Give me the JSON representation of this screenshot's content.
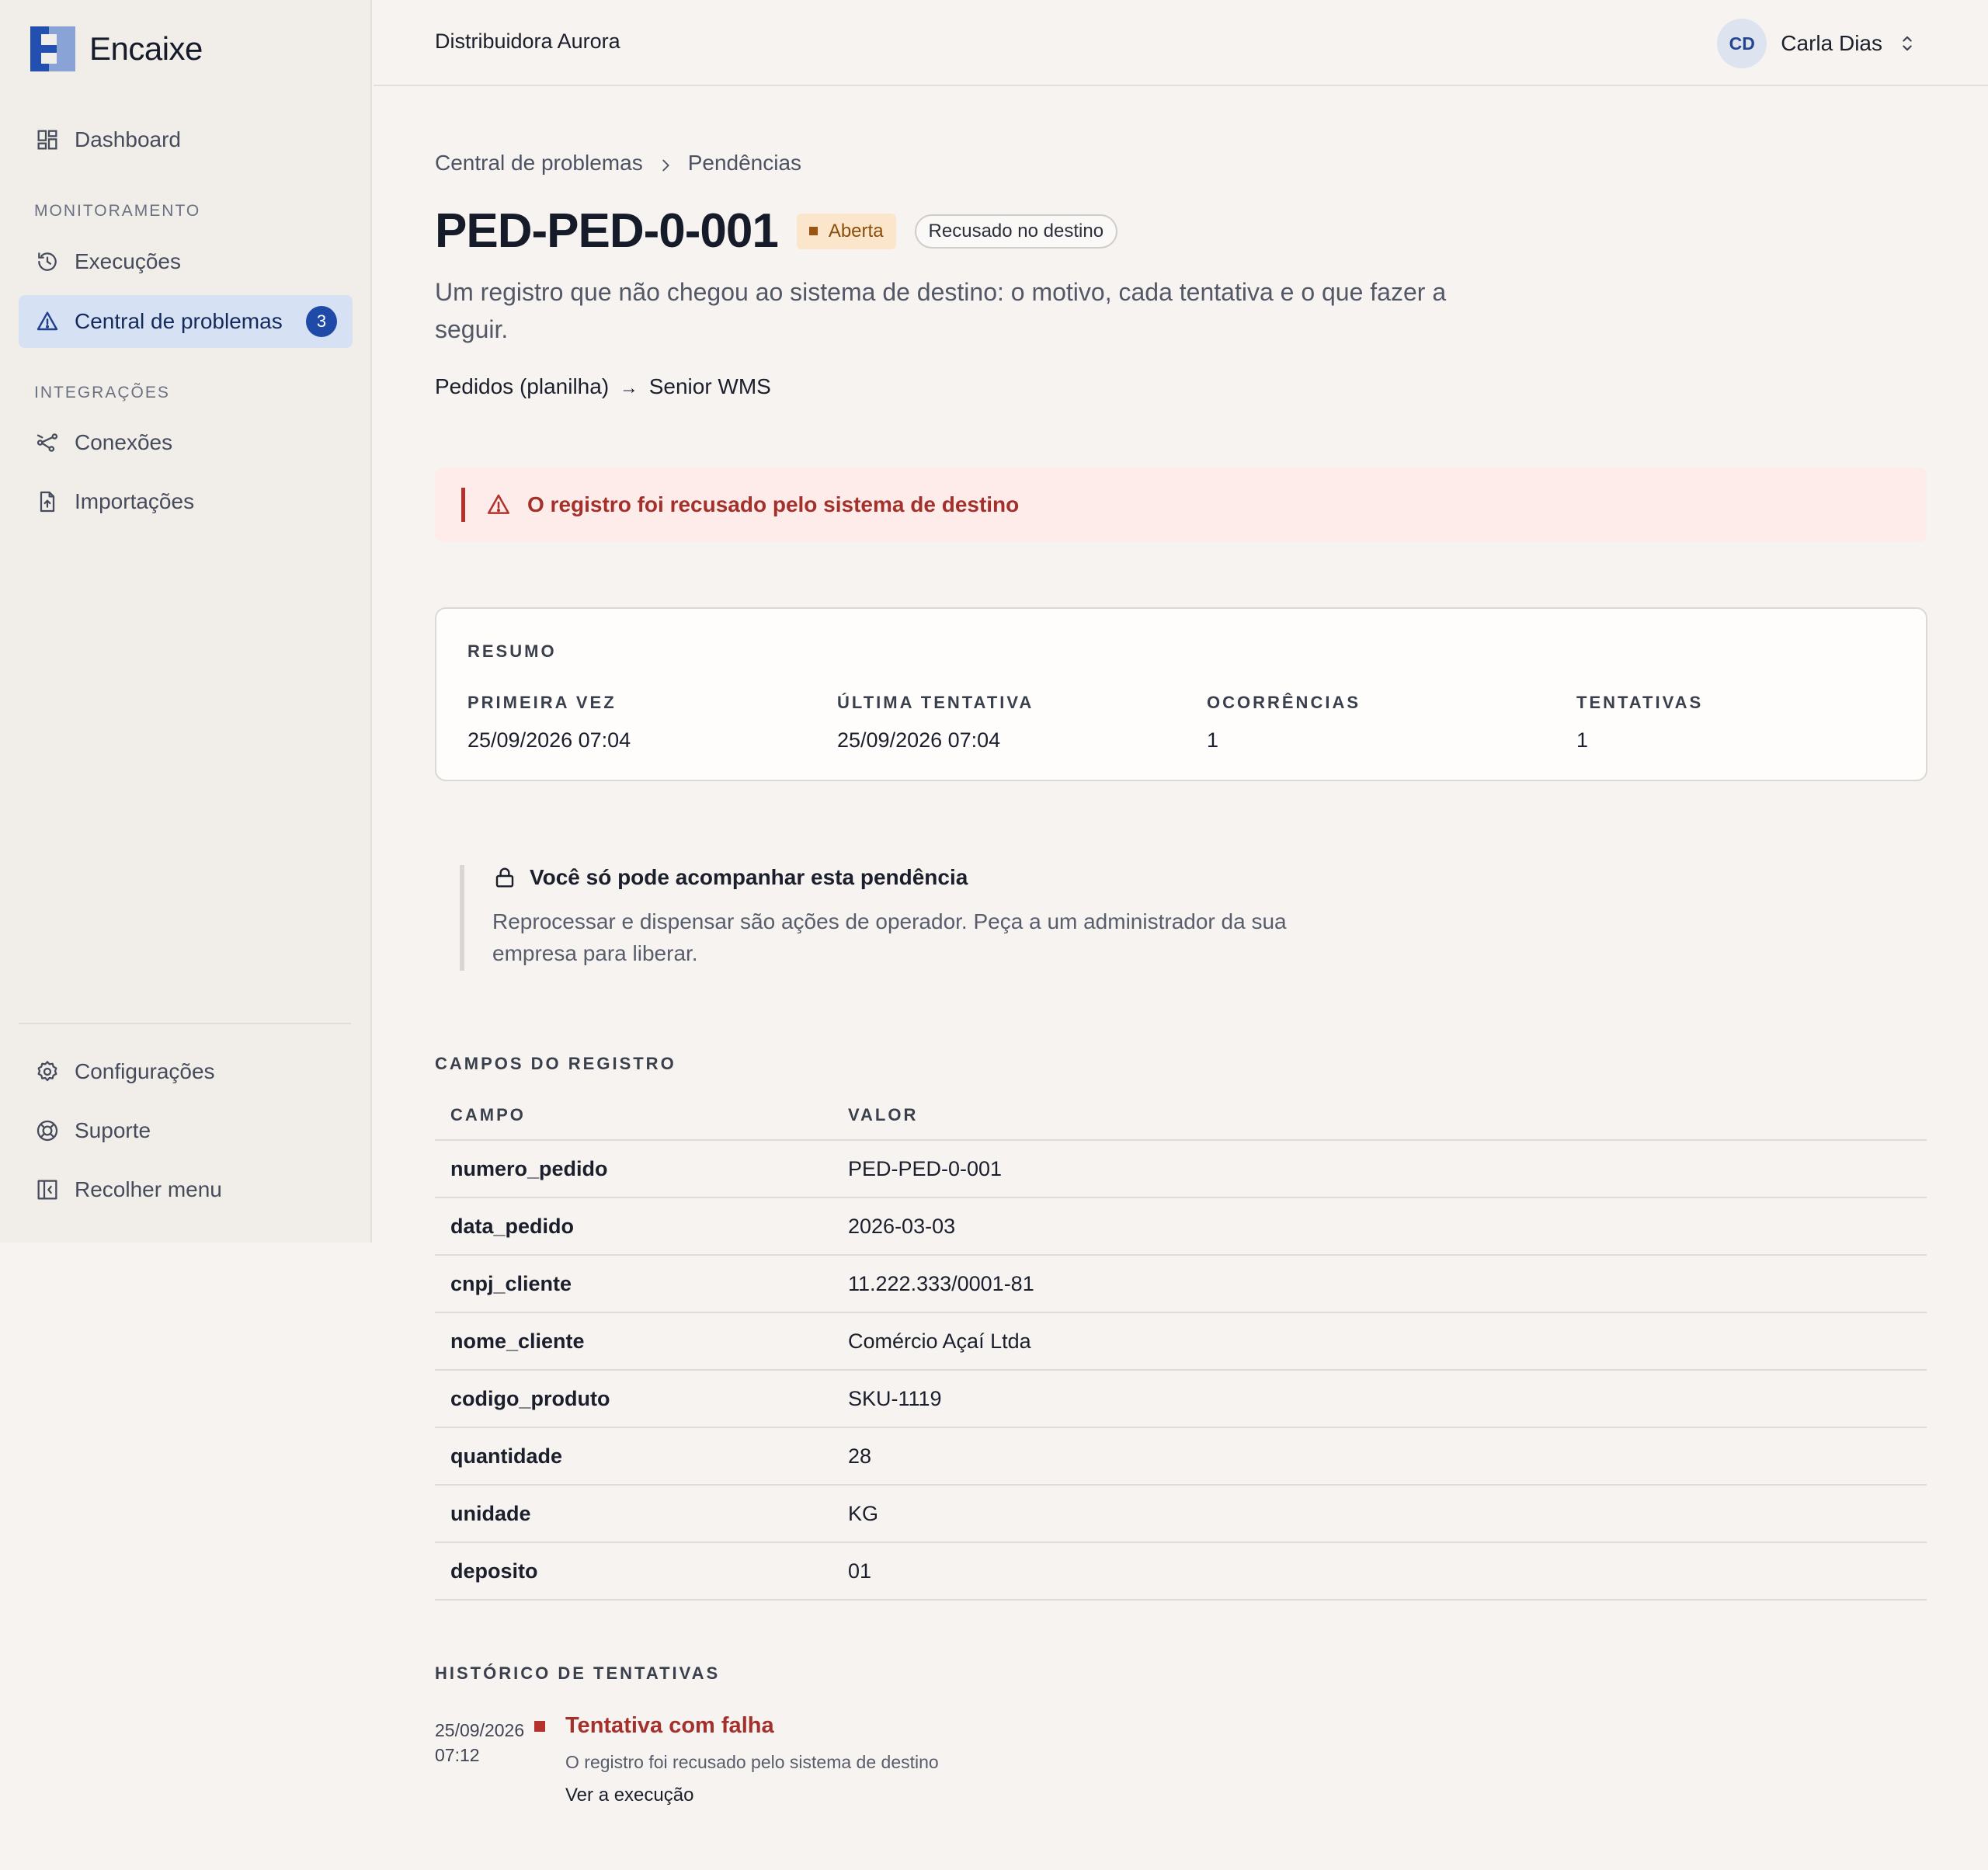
{
  "brand": {
    "name": "Encaixe"
  },
  "sidebar": {
    "top_items": [
      {
        "label": "Dashboard",
        "icon": "dashboard-icon"
      }
    ],
    "sections": [
      {
        "label": "MONITORAMENTO"
      },
      {
        "label": "INTEGRAÇÕES"
      }
    ],
    "monitoring_items": [
      {
        "label": "Execuções",
        "icon": "history-icon"
      },
      {
        "label": "Central de problemas",
        "icon": "warning-icon",
        "badge": "3",
        "active": true
      }
    ],
    "integration_items": [
      {
        "label": "Conexões",
        "icon": "connections-icon"
      },
      {
        "label": "Importações",
        "icon": "file-upload-icon"
      }
    ],
    "bottom_items": [
      {
        "label": "Configurações",
        "icon": "gear-icon"
      },
      {
        "label": "Suporte",
        "icon": "lifebuoy-icon"
      },
      {
        "label": "Recolher menu",
        "icon": "collapse-sidebar-icon"
      }
    ]
  },
  "header": {
    "org_name": "Distribuidora Aurora",
    "user": {
      "initials": "CD",
      "name": "Carla Dias"
    }
  },
  "breadcrumb": [
    "Central de problemas",
    "Pendências"
  ],
  "page": {
    "title": "PED-PED-0-001",
    "status": "Aberta",
    "reason": "Recusado no destino",
    "description": "Um registro que não chegou ao sistema de destino: o motivo, cada tentativa e o que fazer a seguir.",
    "flow": {
      "source": "Pedidos (planilha)",
      "arrow": "→",
      "target": "Senior WMS"
    }
  },
  "alert": {
    "text": "O registro foi recusado pelo sistema de destino"
  },
  "summary": {
    "title": "RESUMO",
    "items": [
      {
        "label": "PRIMEIRA VEZ",
        "value": "25/09/2026 07:04"
      },
      {
        "label": "ÚLTIMA TENTATIVA",
        "value": "25/09/2026 07:04"
      },
      {
        "label": "OCORRÊNCIAS",
        "value": "1"
      },
      {
        "label": "TENTATIVAS",
        "value": "1"
      }
    ]
  },
  "permission_note": {
    "title": "Você só pode acompanhar esta pendência",
    "body": "Reprocessar e dispensar são ações de operador. Peça a um administrador da sua empresa para liberar."
  },
  "fields": {
    "title": "CAMPOS DO REGISTRO",
    "columns": [
      "CAMPO",
      "VALOR"
    ],
    "rows": [
      [
        "numero_pedido",
        "PED-PED-0-001"
      ],
      [
        "data_pedido",
        "2026-03-03"
      ],
      [
        "cnpj_cliente",
        "11.222.333/0001-81"
      ],
      [
        "nome_cliente",
        "Comércio Açaí Ltda"
      ],
      [
        "codigo_produto",
        "SKU-1119"
      ],
      [
        "quantidade",
        "28"
      ],
      [
        "unidade",
        "KG"
      ],
      [
        "deposito",
        "01"
      ]
    ]
  },
  "history": {
    "title": "HISTÓRICO DE TENTATIVAS",
    "items": [
      {
        "date": "25/09/2026",
        "time": "07:12",
        "title": "Tentativa com falha",
        "description": "O registro foi recusado pelo sistema de destino",
        "link": "Ver a execução"
      }
    ]
  },
  "colors": {
    "accent": "#1f4aa8",
    "active_nav_bg": "#d6e1f3",
    "error": "#b3332c",
    "status_open_bg": "#fbe6cc",
    "background": "#f7f3f1"
  }
}
